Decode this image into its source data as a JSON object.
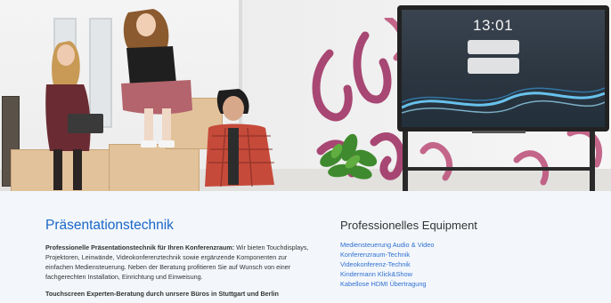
{
  "hero": {
    "tv_time": "13:01"
  },
  "presentation": {
    "title": "Präsentationstechnik",
    "intro_lead": "Professionelle Präsentationstechnik für Ihren Konferenzraum:",
    "intro_body": " Wir bieten Touchdisplays, Projektoren, Leinwände, Videokonferenztechnik sowie ergänzende Komponenten zur einfachen Mediensteuerung. Neben der Beratung profitieren Sie auf Wunsch von einer fachgerechten Installation, Einrichtung und Einweisung.",
    "sub_heading": "Touchscreen Experten-Beratung durch unrsere Büros in Stuttgart und Berlin"
  },
  "equipment": {
    "title": "Professionelles Equipment",
    "links": [
      "Mediensteuerung Audio & Video",
      "Konferenzraum-Technik",
      "Videokonferenz-Technik",
      "Kindermann Klick&Show",
      "Kabellose HDMI Übertragung"
    ]
  },
  "colors": {
    "accent_blue": "#1a66c8",
    "link_blue": "#2f6fd0",
    "section_bg": "#f3f7fb"
  }
}
